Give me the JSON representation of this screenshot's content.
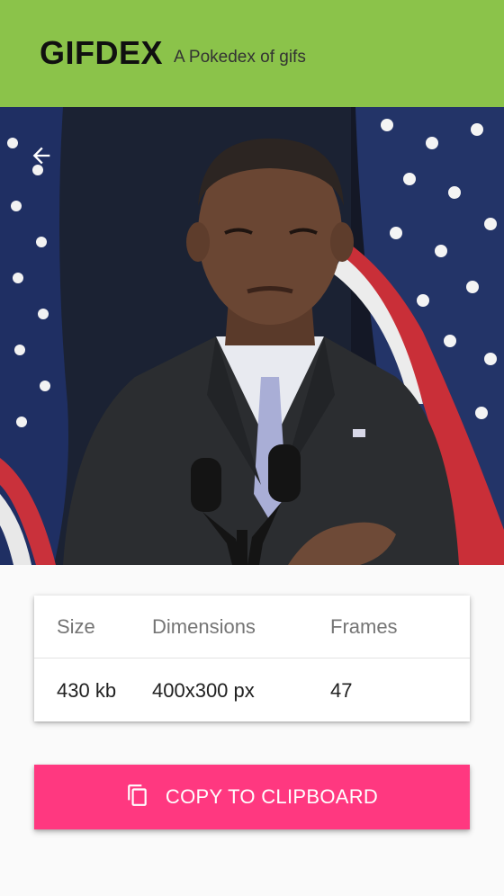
{
  "app": {
    "title": "GIFDEX",
    "subtitle": "A Pokedex of gifs",
    "accent_color": "#8bc34a"
  },
  "gif": {
    "back_icon": "arrow-back-icon",
    "description": "Animated gif of a man in a suit at a podium with microphones in front of American flags"
  },
  "details": {
    "headers": [
      "Size",
      "Dimensions",
      "Frames"
    ],
    "values": [
      "430 kb",
      "400x300 px",
      "47"
    ]
  },
  "action": {
    "label": "COPY TO CLIPBOARD",
    "icon": "copy-icon",
    "color": "#ff3880"
  }
}
